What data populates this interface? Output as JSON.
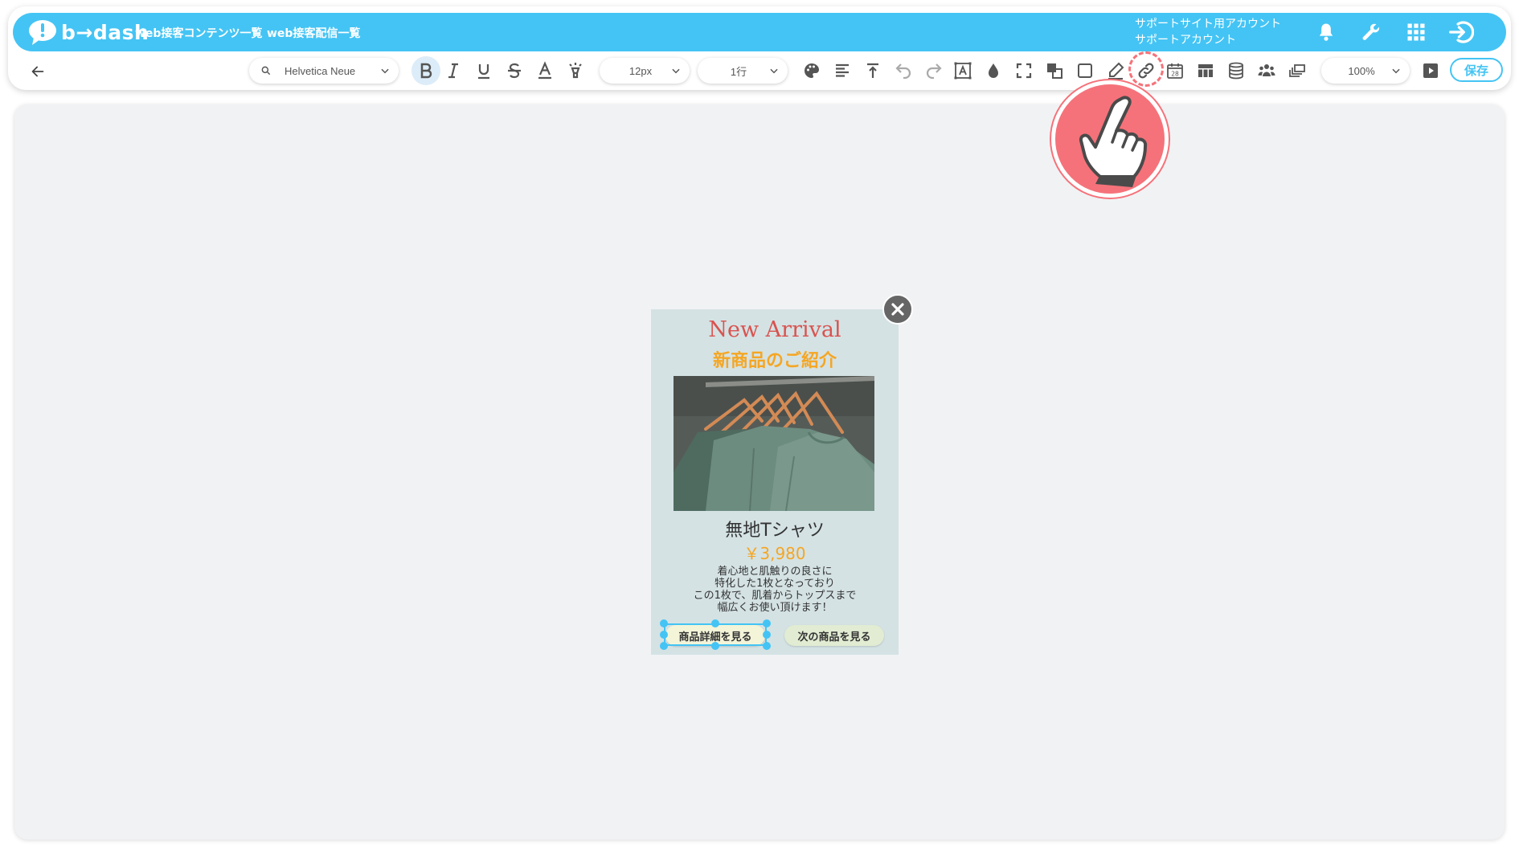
{
  "header": {
    "logo_text": "b→dash",
    "nav": [
      {
        "label": "web接客コンテンツ一覧"
      },
      {
        "label": "web接客配信一覧"
      }
    ],
    "account": {
      "line1": "サポートサイト用アカウント",
      "line2": "サポートアカウント"
    },
    "icons": [
      "bell-icon",
      "wrench-icon",
      "apps-grid-icon",
      "logout-icon"
    ]
  },
  "toolbar": {
    "font_family": "Helvetica Neue",
    "font_size": "12px",
    "line_height": "1行",
    "zoom": "100%",
    "save_label": "保存",
    "icons": [
      "back-arrow-icon",
      "search-icon",
      "bold-icon",
      "italic-icon",
      "underline-icon",
      "strikethrough-icon",
      "font-color-icon",
      "highlight-icon",
      "palette-icon",
      "align-left-icon",
      "vertical-align-top-icon",
      "undo-icon",
      "redo-icon",
      "text-box-icon",
      "fill-drop-icon",
      "fullscreen-icon",
      "layer-icon",
      "border-icon",
      "pen-icon",
      "link-icon",
      "calendar-icon",
      "table-icon",
      "database-icon",
      "users-icon",
      "copy-layers-icon",
      "preview-play-icon"
    ],
    "calendar_day": "28",
    "active_tool": "link"
  },
  "popup": {
    "title_en": "New Arrival",
    "title_ja": "新商品のご紹介",
    "product_name": "無地Tシャツ",
    "price": "￥3,980",
    "description": [
      "着心地と肌触りの良さに",
      "特化した1枚となっており",
      "この1枚で、肌着からトップスまで",
      "幅広くお使い頂けます！"
    ],
    "button_detail": "商品詳細を見る",
    "button_next": "次の商品を見る"
  },
  "colors": {
    "brand": "#44c4f4",
    "accent_callout": "#f5727a",
    "popup_bg": "#d4e2e4",
    "title_red": "#d9534f",
    "price_orange": "#f5a623"
  }
}
